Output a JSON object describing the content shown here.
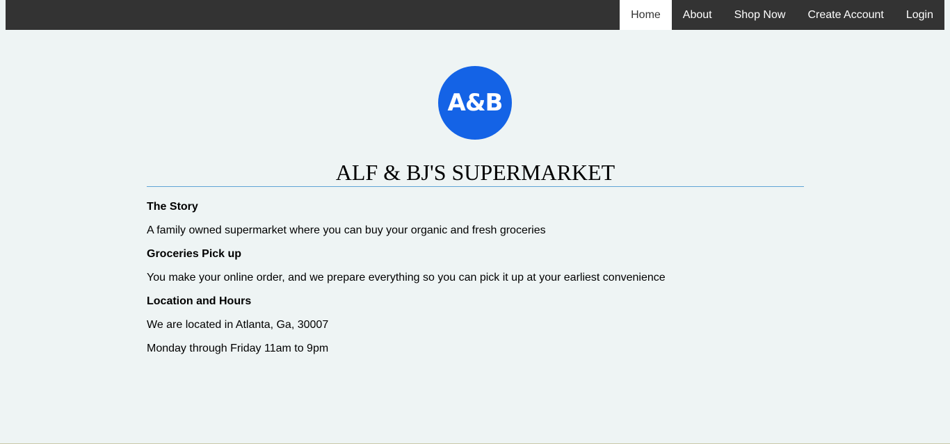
{
  "nav": {
    "items": [
      {
        "label": "Home",
        "active": true
      },
      {
        "label": "About",
        "active": false
      },
      {
        "label": "Shop Now",
        "active": false
      },
      {
        "label": "Create Account",
        "active": false
      },
      {
        "label": "Login",
        "active": false
      }
    ]
  },
  "logo": {
    "text": "A&B",
    "color": "#1463e6"
  },
  "main": {
    "title": "ALF & BJ'S SUPERMARKET",
    "sections": [
      {
        "heading": "The Story",
        "lines": [
          "A family owned supermarket where you can buy your organic and fresh groceries"
        ]
      },
      {
        "heading": "Groceries Pick up",
        "lines": [
          "You make your online order, and we prepare everything so you can pick it up at your earliest convenience"
        ]
      },
      {
        "heading": "Location and Hours",
        "lines": [
          "We are located in Atlanta, Ga, 30007",
          "Monday through Friday 11am to 9pm"
        ]
      }
    ]
  },
  "colors": {
    "nav_background": "#333333",
    "page_background": "#eef4f4",
    "title_underline": "#5fa3d6"
  }
}
